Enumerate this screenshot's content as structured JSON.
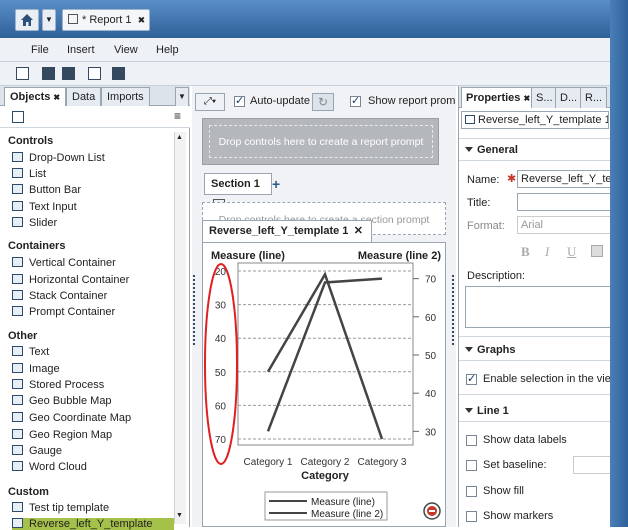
{
  "app": {
    "report_tab": "* Report 1",
    "report_tab_close": "✖"
  },
  "menu": [
    "File",
    "Insert",
    "View",
    "Help"
  ],
  "left_panel": {
    "tabs": [
      {
        "label": "Objects",
        "close": "✖"
      },
      {
        "label": "Data"
      },
      {
        "label": "Imports"
      }
    ],
    "sections": [
      {
        "title": "Controls",
        "items": [
          "Drop-Down List",
          "List",
          "Button Bar",
          "Text Input",
          "Slider"
        ]
      },
      {
        "title": "Containers",
        "items": [
          "Vertical Container",
          "Horizontal Container",
          "Stack Container",
          "Prompt Container"
        ]
      },
      {
        "title": "Other",
        "items": [
          "Text",
          "Image",
          "Stored Process",
          "Geo Bubble Map",
          "Geo Coordinate Map",
          "Geo Region Map",
          "Gauge",
          "Word Cloud"
        ]
      },
      {
        "title": "Custom",
        "items": [
          "Test tip template",
          "Reverse_left_Y_template"
        ]
      }
    ]
  },
  "canvas": {
    "auto_update": "Auto-update",
    "show_prompt": "Show report prompt",
    "report_prompt": "Drop controls here to create a report prompt",
    "section_tab": "Section 1",
    "section_prompt": "Drop controls here to create a section prompt",
    "chart_tab": "Reverse_left_Y_template 1",
    "chart_tab_close": "✕"
  },
  "chart_data": {
    "type": "line",
    "categories": [
      "Category 1",
      "Category 2",
      "Category 3"
    ],
    "xlabel": "Category",
    "left_axis": {
      "label": "Measure (line)",
      "ticks": [
        20,
        30,
        40,
        50,
        60,
        70
      ],
      "range": [
        20,
        70
      ],
      "reversed": true
    },
    "right_axis": {
      "label": "Measure (line 2)",
      "ticks": [
        30,
        40,
        50,
        60,
        70
      ],
      "range": [
        28,
        72
      ]
    },
    "series": [
      {
        "name": "Measure (line)",
        "axis": "left",
        "values": [
          50,
          21,
          70
        ]
      },
      {
        "name": "Measure (line 2)",
        "axis": "right",
        "values": [
          30,
          69,
          70
        ]
      }
    ],
    "legend": [
      "Measure (line)",
      "Measure (line 2)"
    ],
    "grid": true,
    "legend_position": "bottom"
  },
  "right_panel": {
    "tabs": [
      {
        "label": "Properties",
        "close": "✖"
      },
      {
        "label": "S..."
      },
      {
        "label": "D..."
      },
      {
        "label": "R..."
      }
    ],
    "selector": "Reverse_left_Y_template 1",
    "general": "General",
    "name_label": "Name:",
    "name_value": "Reverse_left_Y_tem",
    "title_label": "Title:",
    "format_label": "Format:",
    "format_value": "Arial",
    "format_buttons": [
      "B",
      "I",
      "U"
    ],
    "description_label": "Description:",
    "graphs": "Graphs",
    "enable_selection": "Enable selection in the view",
    "line1": "Line 1",
    "show_data_labels": "Show data labels",
    "set_baseline": "Set baseline:",
    "show_fill": "Show fill",
    "show_markers": "Show markers"
  }
}
